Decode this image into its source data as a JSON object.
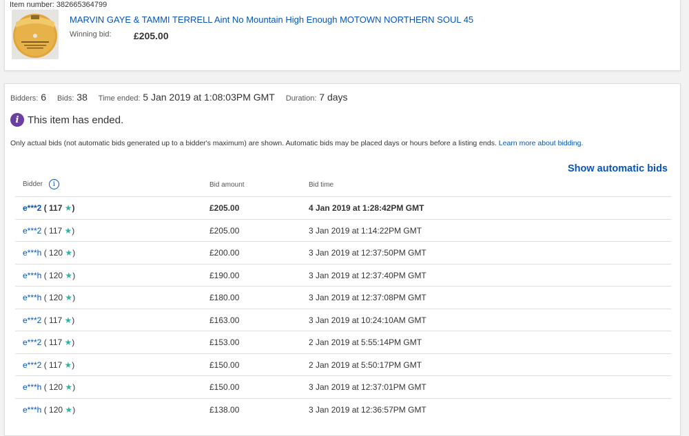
{
  "item": {
    "number_label": "Item number: 382665364799",
    "title": "MARVIN GAYE & TAMMI TERRELL Aint No Mountain High Enough MOTOWN NORTHERN SOUL 45",
    "winning_bid_label": "Winning bid:",
    "winning_bid_value": "£205.00"
  },
  "summary": {
    "bidders_label": "Bidders:",
    "bidders_value": "6",
    "bids_label": "Bids:",
    "bids_value": "38",
    "time_ended_label": "Time ended:",
    "time_ended_value": "5 Jan 2019 at 1:08:03PM GMT",
    "duration_label": "Duration:",
    "duration_value": "7 days"
  },
  "ended_message": "This item has ended.",
  "note_text": "Only actual bids (not automatic bids generated up to a bidder's maximum) are shown. Automatic bids may be placed days or hours before a listing ends. ",
  "note_link": "Learn more about bidding.",
  "show_automatic_bids": "Show automatic bids",
  "table": {
    "headers": {
      "bidder": "Bidder",
      "amount": "Bid amount",
      "time": "Bid time"
    },
    "rows": [
      {
        "bidder": "e***2",
        "feedback": "117",
        "amount": "£205.00",
        "time": "4 Jan 2019 at 1:28:42PM GMT",
        "winning": true
      },
      {
        "bidder": "e***2",
        "feedback": "117",
        "amount": "£205.00",
        "time": "3 Jan 2019 at 1:14:22PM GMT",
        "winning": false
      },
      {
        "bidder": "e***h",
        "feedback": "120",
        "amount": "£200.00",
        "time": "3 Jan 2019 at 12:37:50PM GMT",
        "winning": false
      },
      {
        "bidder": "e***h",
        "feedback": "120",
        "amount": "£190.00",
        "time": "3 Jan 2019 at 12:37:40PM GMT",
        "winning": false
      },
      {
        "bidder": "e***h",
        "feedback": "120",
        "amount": "£180.00",
        "time": "3 Jan 2019 at 12:37:08PM GMT",
        "winning": false
      },
      {
        "bidder": "e***2",
        "feedback": "117",
        "amount": "£163.00",
        "time": "3 Jan 2019 at 10:24:10AM GMT",
        "winning": false
      },
      {
        "bidder": "e***2",
        "feedback": "117",
        "amount": "£153.00",
        "time": "2 Jan 2019 at 5:55:14PM GMT",
        "winning": false
      },
      {
        "bidder": "e***2",
        "feedback": "117",
        "amount": "£150.00",
        "time": "2 Jan 2019 at 5:50:17PM GMT",
        "winning": false
      },
      {
        "bidder": "e***h",
        "feedback": "120",
        "amount": "£150.00",
        "time": "3 Jan 2019 at 12:37:01PM GMT",
        "winning": false
      },
      {
        "bidder": "e***h",
        "feedback": "120",
        "amount": "£138.00",
        "time": "3 Jan 2019 at 12:36:57PM GMT",
        "winning": false
      }
    ]
  },
  "colors": {
    "link": "#0654ba",
    "info_badge": "#6b3fa0",
    "star": "#2bb5a5"
  },
  "icons": {
    "ended": "info-filled-icon",
    "bidder_info": "info-outline-icon",
    "feedback": "star-icon",
    "thumbnail": "record-label-thumbnail"
  }
}
